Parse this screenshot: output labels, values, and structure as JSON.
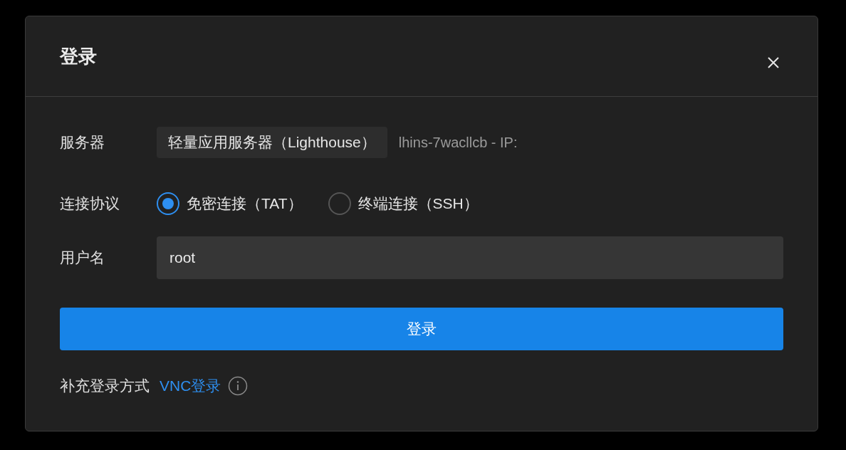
{
  "dialog": {
    "title": "登录"
  },
  "server": {
    "label": "服务器",
    "type": "轻量应用服务器（Lighthouse）",
    "instance": "lhins-7wacllcb - IP:"
  },
  "protocol": {
    "label": "连接协议",
    "options": [
      {
        "label": "免密连接（TAT）",
        "selected": true
      },
      {
        "label": "终端连接（SSH）",
        "selected": false
      }
    ]
  },
  "username": {
    "label": "用户名",
    "value": "root"
  },
  "login_button": "登录",
  "alt_login": {
    "label": "补充登录方式",
    "link": "VNC登录"
  }
}
